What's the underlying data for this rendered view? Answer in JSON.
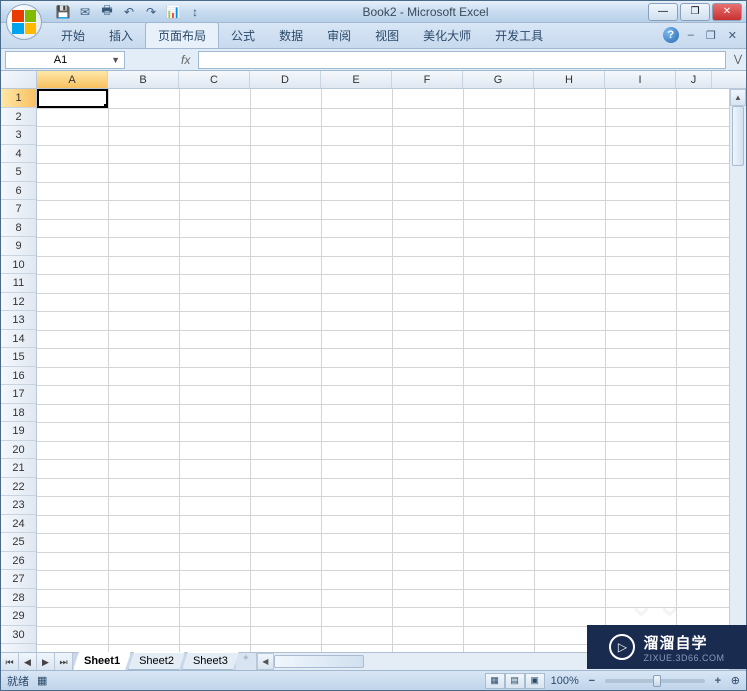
{
  "title": "Book2 - Microsoft Excel",
  "qat": {
    "save": "💾",
    "mail": "✉",
    "print": "🖶",
    "undo": "↶",
    "redo": "↷",
    "chart": "📊",
    "sort": "↕"
  },
  "win": {
    "min": "—",
    "max": "❐",
    "close": "✕"
  },
  "ribbon": {
    "tabs": [
      "开始",
      "插入",
      "页面布局",
      "公式",
      "数据",
      "审阅",
      "视图",
      "美化大师",
      "开发工具"
    ],
    "active_index": 2,
    "help": "?",
    "mdi_min": "–",
    "mdi_restore": "❐",
    "mdi_close": "✕"
  },
  "formula_bar": {
    "name_box": "A1",
    "fx": "fx"
  },
  "grid": {
    "columns": [
      "A",
      "B",
      "C",
      "D",
      "E",
      "F",
      "G",
      "H",
      "I",
      "J"
    ],
    "rows": 30,
    "active_col": "A",
    "active_row": 1
  },
  "sheet_nav": {
    "first": "⏮",
    "prev": "◀",
    "next": "▶",
    "last": "⏭"
  },
  "sheets": [
    "Sheet1",
    "Sheet2",
    "Sheet3"
  ],
  "active_sheet": 0,
  "status": {
    "mode": "就绪",
    "macro": "▦",
    "zoom": "100%",
    "minus": "−",
    "plus": "+",
    "zoom_expand": "⊕"
  },
  "watermark": {
    "play": "▷",
    "text": "溜溜自学",
    "sub": "ZIXUE.3D66.COM"
  }
}
